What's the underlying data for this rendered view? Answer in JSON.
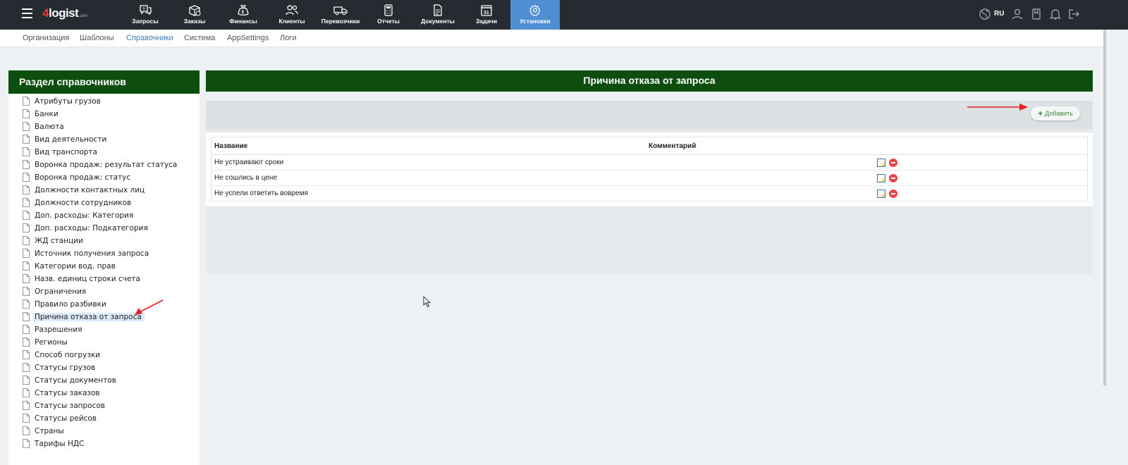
{
  "topbar": {
    "logo": {
      "brand_digit": "4",
      "brand_text": "logist",
      "brand_suffix": ".com"
    },
    "nav_items": [
      {
        "label": "Запросы",
        "icon": "chat-question-icon"
      },
      {
        "label": "Заказы",
        "icon": "box-check-icon"
      },
      {
        "label": "Финансы",
        "icon": "money-bag-icon"
      },
      {
        "label": "Клиенты",
        "icon": "users-icon"
      },
      {
        "label": "Перевозчики",
        "icon": "truck-icon"
      },
      {
        "label": "Отчеты",
        "icon": "calculator-icon"
      },
      {
        "label": "Документы",
        "icon": "document-icon"
      },
      {
        "label": "Задачи",
        "icon": "calendar-icon",
        "calendar_day": "31"
      },
      {
        "label": "Установки",
        "icon": "gear-icon",
        "active": true
      }
    ],
    "language": "RU"
  },
  "subnav": {
    "items": [
      {
        "label": "Организация"
      },
      {
        "label": "Шаблоны"
      },
      {
        "label": "Справочники",
        "active": true
      },
      {
        "label": "Система"
      },
      {
        "label": "AppSettings"
      },
      {
        "label": "Логи"
      }
    ]
  },
  "left_panel": {
    "title": "Раздел справочников",
    "items": [
      "Атрибуты грузов",
      "Банки",
      "Валюта",
      "Вид деятельности",
      "Вид транспорта",
      "Воронка продаж: результат статуса",
      "Воронка продаж: статус",
      "Должности контактных лиц",
      "Должности сотрудников",
      "Доп. расходы: Категория",
      "Доп. расходы: Подкатегория",
      "ЖД станции",
      "Источник получения запроса",
      "Категории вод. прав",
      "Назв. единиц строки счета",
      "Ограничения",
      "Правило разбивки",
      "Причина отказа от запроса",
      "Разрешения",
      "Регионы",
      "Способ погрузки",
      "Статусы грузов",
      "Статусы документов",
      "Статусы заказов",
      "Статусы запросов",
      "Статусы рейсов",
      "Страны",
      "Тарифы НДС"
    ],
    "selected_index": 17
  },
  "main": {
    "title": "Причина отказа от запроса",
    "add_button": "Добавить",
    "table": {
      "columns": [
        "Название",
        "Комментарий"
      ],
      "rows": [
        {
          "name": "Не устраивают сроки",
          "comment": ""
        },
        {
          "name": "Не сошлись в цене",
          "comment": ""
        },
        {
          "name": "Не успели ответить вовремя",
          "comment": ""
        }
      ]
    }
  },
  "colors": {
    "topbar_bg": "#262b31",
    "active_nav": "#4f8fd1",
    "panel_header": "#0d4d0e",
    "annotation_arrow": "#e31e24",
    "add_green": "#3b8a3b"
  }
}
